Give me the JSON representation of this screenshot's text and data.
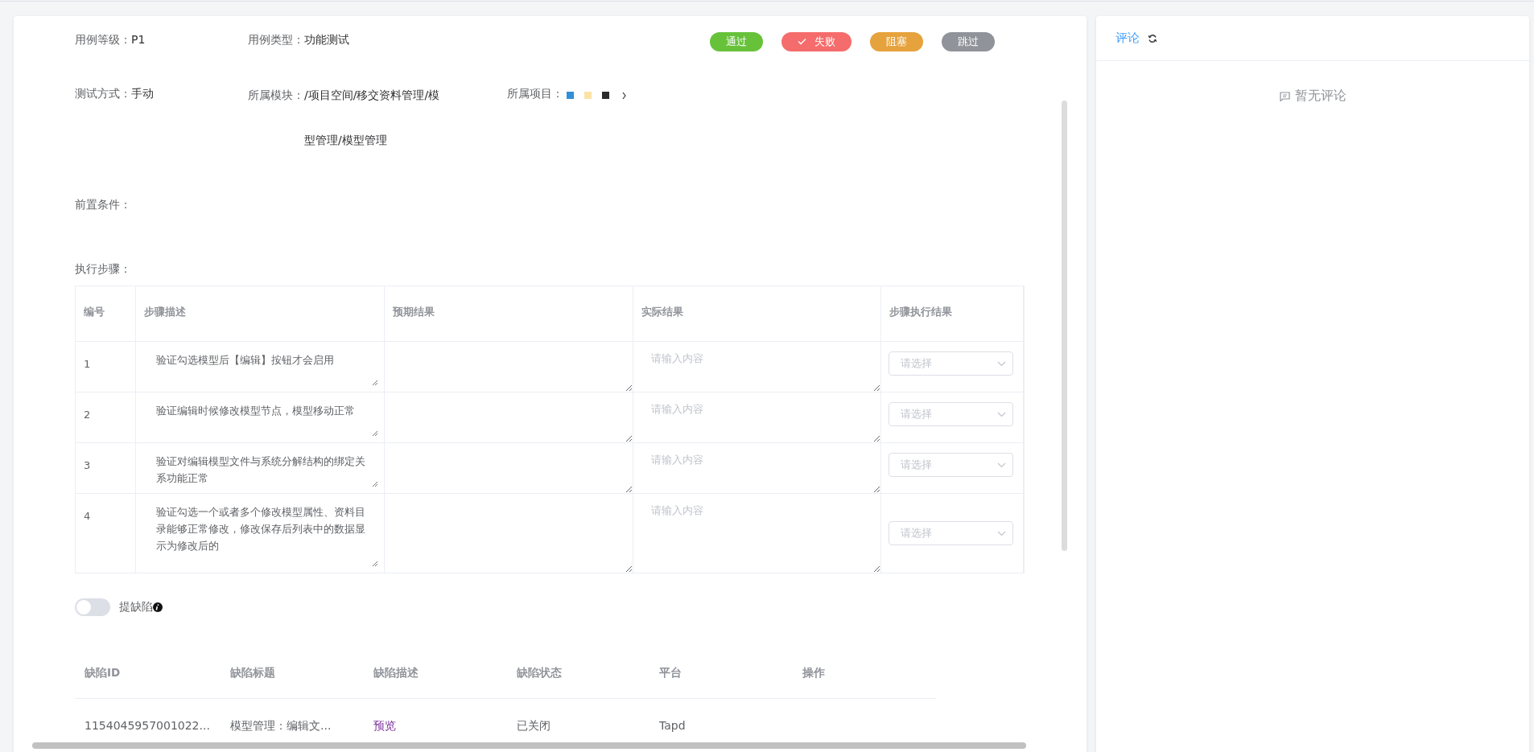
{
  "result_buttons": [
    {
      "label": "通过",
      "color": "#67c23a",
      "selected": false
    },
    {
      "label": "失败",
      "color": "#f56c6c",
      "selected": true
    },
    {
      "label": "阻塞",
      "color": "#e6a23c",
      "selected": false
    },
    {
      "label": "跳过",
      "color": "#909399",
      "selected": false
    }
  ],
  "case_info": {
    "priority": {
      "label": "用例等级：",
      "value": "P1"
    },
    "type": {
      "label": "用例类型：",
      "value": "功能测试"
    },
    "method": {
      "label": "测试方式：",
      "value": "手动"
    },
    "module": {
      "label": "所属模块：",
      "value_lines": [
        "/项目空间/移交资料管理/模",
        "型管理/模型管理"
      ]
    },
    "project": {
      "label": "所属项目："
    },
    "precondition": {
      "label": "前置条件："
    },
    "steps_label": "执行步骤："
  },
  "steps_table": {
    "columns": [
      "编号",
      "步骤描述",
      "预期结果",
      "实际结果",
      "步骤执行结果"
    ],
    "rows": [
      {
        "number": "1",
        "description": "验证勾选模型后【编辑】按钮才会启用",
        "actual_placeholder": "请输入内容",
        "result_placeholder": "请选择"
      },
      {
        "number": "2",
        "description": "验证编辑时候修改模型节点，模型移动正常",
        "actual_placeholder": "请输入内容",
        "result_placeholder": "请选择"
      },
      {
        "number": "3",
        "description": "验证对编辑模型文件与系统分解结构的绑定关系功能正常",
        "actual_placeholder": "请输入内容",
        "result_placeholder": "请选择"
      },
      {
        "number": "4",
        "description": "验证勾选一个或者多个修改模型属性、资料目录能够正常修改，修改保存后列表中的数据显示为修改后的",
        "actual_placeholder": "请输入内容",
        "result_placeholder": "请选择"
      }
    ]
  },
  "defect_toggle": {
    "label": "提缺陷",
    "on": false
  },
  "defects_table": {
    "columns": [
      "缺陷ID",
      "缺陷标题",
      "缺陷描述",
      "缺陷状态",
      "平台",
      "操作"
    ],
    "rows": [
      {
        "id": "1154045957001022...",
        "title": "模型管理：编辑文...",
        "description_link": "预览",
        "status": "已关闭",
        "platform": "Tapd"
      }
    ]
  },
  "comments": {
    "title": "评论",
    "empty_text": "暂无评论"
  }
}
